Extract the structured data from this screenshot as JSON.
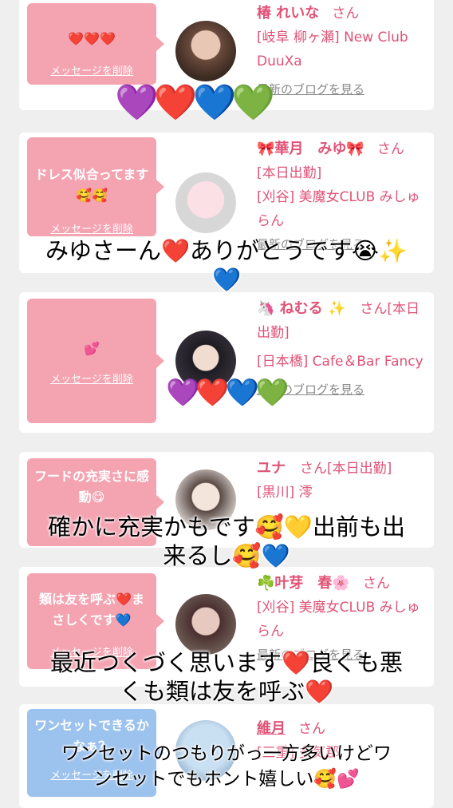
{
  "cards": [
    {
      "message": "❤️❤️❤️",
      "delete_label": "メッセージを削除",
      "name": "椿 れいな",
      "san": "さん",
      "shop": "[岐阜 柳ヶ瀬] New Club DuuXa",
      "blog": "最新のブログを見る"
    },
    {
      "message": "ドレス似合ってます🥰🥰",
      "delete_label": "メッセージを削除",
      "name": "🎀華月　みゆ🎀",
      "san": "さん",
      "shop_line1": "[本日出勤]",
      "shop": "[刈谷] 美魔女CLUB みしゅらん",
      "blog": "最新のブログを見る"
    },
    {
      "message": "💕",
      "delete_label": "メッセージを削除",
      "name": "🦄 ねむる ✨",
      "san": "さん[本日出勤]",
      "shop": "[日本橋] Cafe＆Bar Fancy",
      "blog": "最新のブログを見る"
    },
    {
      "message": "フードの充実さに感動😋",
      "delete_label": "メッセージを削除",
      "name": "ユナ",
      "san": "さん[本日出勤]",
      "shop": "[黒川] 澪",
      "blog": "最新のブログを見る"
    },
    {
      "message": "類は友を呼ぶ❤️まさしくです💙",
      "delete_label": "メッセージを削除",
      "name": "☘️叶芽　春🌸",
      "san": "さん",
      "shop": "[刈谷] 美魔女CLUB みしゅらん",
      "blog": "最新のブログを見る"
    },
    {
      "message": "ワンセットできるかなぁ？",
      "delete_label": "メッセージを削除",
      "name": "維月",
      "san": "さん",
      "shop": "[三重] 多気郡",
      "blog": ""
    }
  ],
  "overlays": {
    "hearts_top": "💜❤️💙💚",
    "caption1_line1": "みゆさーん❤️ありがとうです😭✨",
    "caption1_line2": "💙",
    "hearts_mid": "💜❤️💙💚",
    "caption2_line1": "確かに充実かもです🥰💛出前も出",
    "caption2_line2": "来るし🥰💙",
    "caption3_line1": "最近つくづく思います❤️良くも悪",
    "caption3_line2": "くも類は友を呼ぶ❤️",
    "caption4_line1": "ワンセットのつもりがっ一方多いけどワ",
    "caption4_line2": "ンセットでもホント嬉しい🥰💕"
  },
  "colors": {
    "accent": "#e05276",
    "bubble_pink": "#f4a3b1",
    "bubble_blue": "#9cc2ee",
    "background": "#efefef"
  }
}
